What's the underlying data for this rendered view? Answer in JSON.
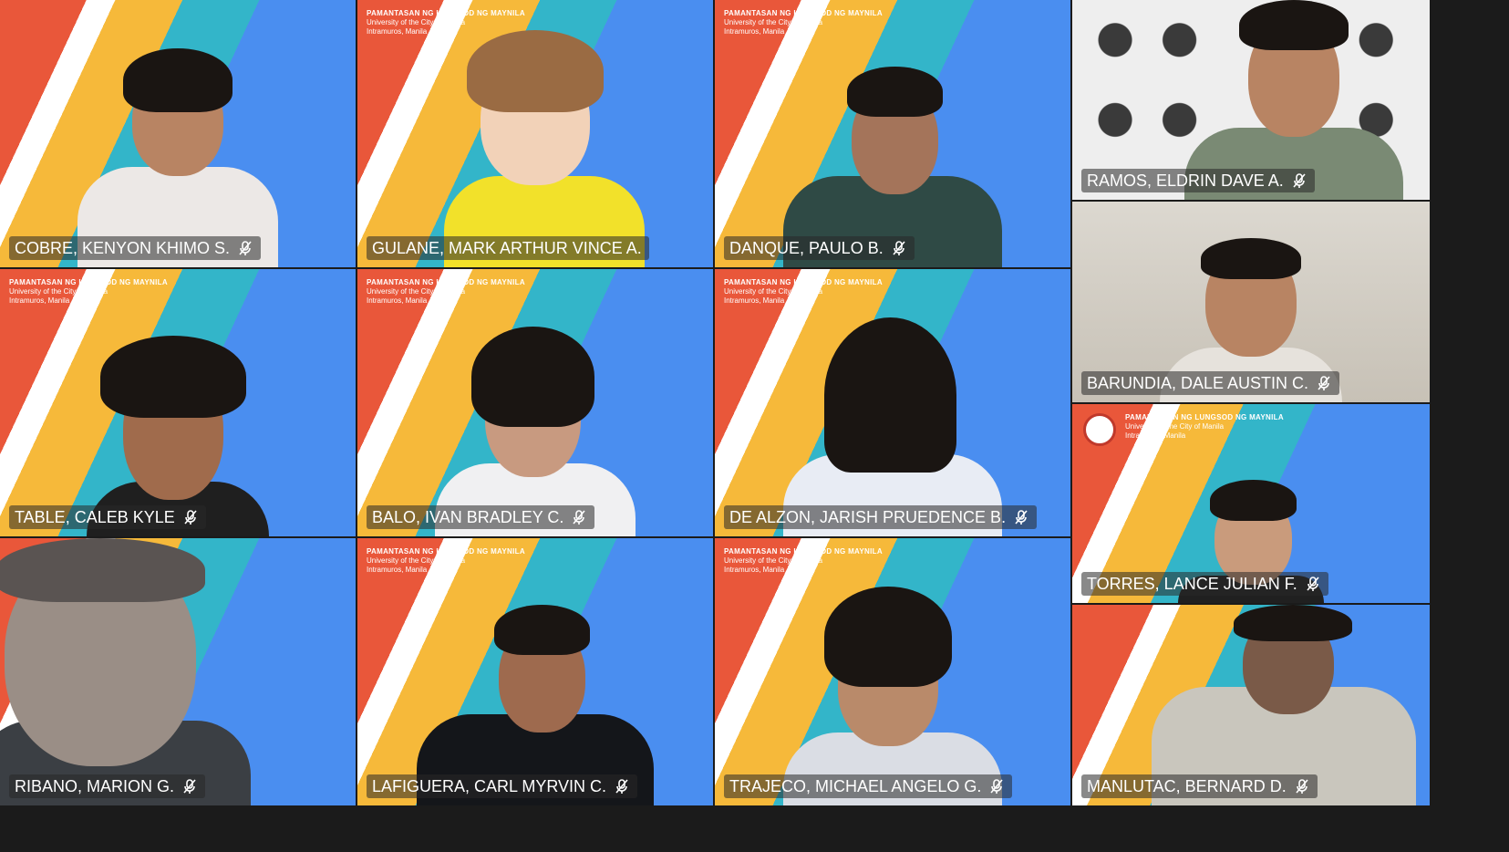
{
  "university": {
    "line1": "PAMANTASAN NG LUNGSOD NG MAYNILA",
    "line2": "University of the City of Manila",
    "line3": "Intramuros, Manila"
  },
  "participants": [
    {
      "name": "COBRE, KENYON KHIMO S.",
      "muted": true
    },
    {
      "name": "GULANE, MARK ARTHUR VINCE A.",
      "muted": false
    },
    {
      "name": "DANQUE, PAULO B.",
      "muted": true
    },
    {
      "name": "RAMOS, ELDRIN DAVE A.",
      "muted": true
    },
    {
      "name": "TABLE, CALEB KYLE",
      "muted": true
    },
    {
      "name": "BALO, IVAN BRADLEY C.",
      "muted": true
    },
    {
      "name": "DE ALZON, JARISH PRUEDENCE B.",
      "muted": true
    },
    {
      "name": "BARUNDIA, DALE AUSTIN C.",
      "muted": true
    },
    {
      "name": "TORRES, LANCE JULIAN F.",
      "muted": true
    },
    {
      "name": "RIBANO, MARION G.",
      "muted": true
    },
    {
      "name": "LAFIGUERA, CARL MYRVIN C.",
      "muted": true
    },
    {
      "name": "TRAJECO, MICHAEL ANGELO G.",
      "muted": true
    },
    {
      "name": "MANLUTAC, BERNARD D.",
      "muted": true
    }
  ],
  "icons": {
    "muted": "mic-muted-icon"
  }
}
